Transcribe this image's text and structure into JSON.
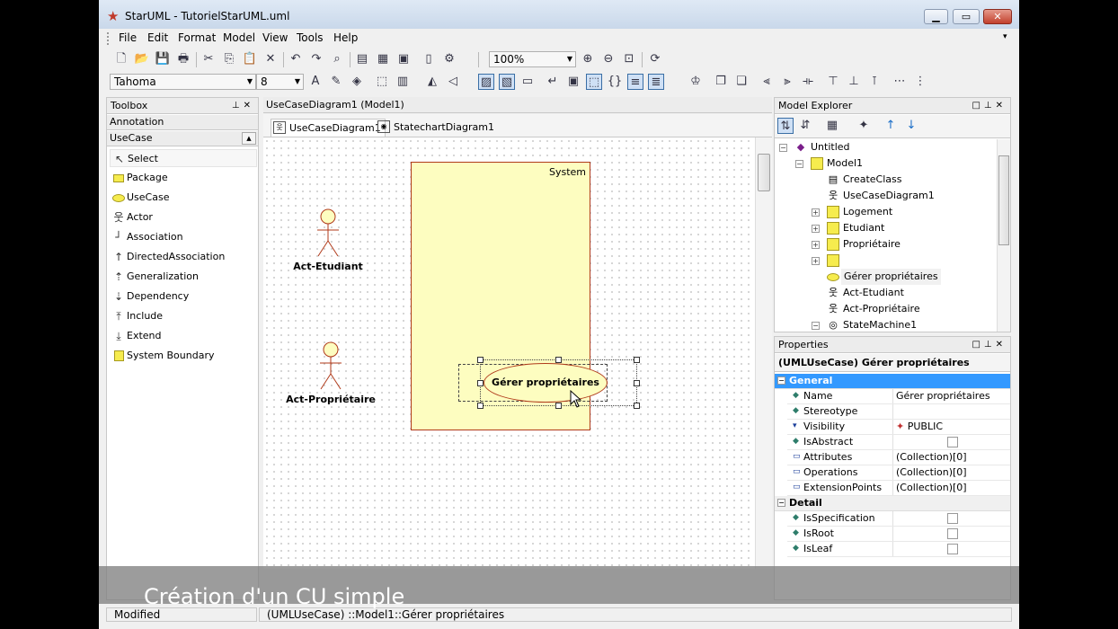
{
  "window": {
    "title": "StarUML - TutorielStarUML.uml"
  },
  "menubar": [
    "File",
    "Edit",
    "Format",
    "Model",
    "View",
    "Tools",
    "Help"
  ],
  "toolbar": {
    "zoom": "100%",
    "font_name": "Tahoma",
    "font_size": "8"
  },
  "toolbox": {
    "title": "Toolbox",
    "sections": [
      "Annotation",
      "UseCase"
    ],
    "items": [
      "Select",
      "Package",
      "UseCase",
      "Actor",
      "Association",
      "DirectedAssociation",
      "Generalization",
      "Dependency",
      "Include",
      "Extend",
      "System Boundary"
    ]
  },
  "editor": {
    "title": "UseCaseDiagram1 (Model1)",
    "tabs": [
      "UseCaseDiagram1",
      "StatechartDiagram1"
    ],
    "diagram": {
      "system_label": "System",
      "actors": [
        "Act-Etudiant",
        "Act-Propriétaire"
      ],
      "usecase": "Gérer propriétaires"
    }
  },
  "model_explorer": {
    "title": "Model Explorer",
    "tree": [
      "Untitled",
      "Model1",
      "CreateClass",
      "UseCaseDiagram1",
      "Logement",
      "Etudiant",
      "Propriétaire",
      "",
      "Gérer propriétaires",
      "Act-Etudiant",
      "Act-Propriétaire",
      "StateMachine1"
    ]
  },
  "properties": {
    "title": "Properties",
    "header": "(UMLUseCase) Gérer propriétaires",
    "general_label": "General",
    "detail_label": "Detail",
    "rows": [
      {
        "name": "Name",
        "value": "Gérer propriétaires"
      },
      {
        "name": "Stereotype",
        "value": ""
      },
      {
        "name": "Visibility",
        "value": "PUBLIC"
      },
      {
        "name": "IsAbstract",
        "value": ""
      },
      {
        "name": "Attributes",
        "value": "(Collection)[0]"
      },
      {
        "name": "Operations",
        "value": "(Collection)[0]"
      },
      {
        "name": "ExtensionPoints",
        "value": "(Collection)[0]"
      }
    ],
    "detail_rows": [
      {
        "name": "IsSpecification"
      },
      {
        "name": "IsRoot"
      },
      {
        "name": "IsLeaf"
      }
    ]
  },
  "statusbar": {
    "state": "Modified",
    "path": "(UMLUseCase) ::Model1::Gérer propriétaires"
  },
  "caption": "Création d'un CU simple",
  "colors": {
    "diagram_fill": "#fdfdc0",
    "diagram_border": "#b03a1a",
    "selection": "#3399ff"
  }
}
